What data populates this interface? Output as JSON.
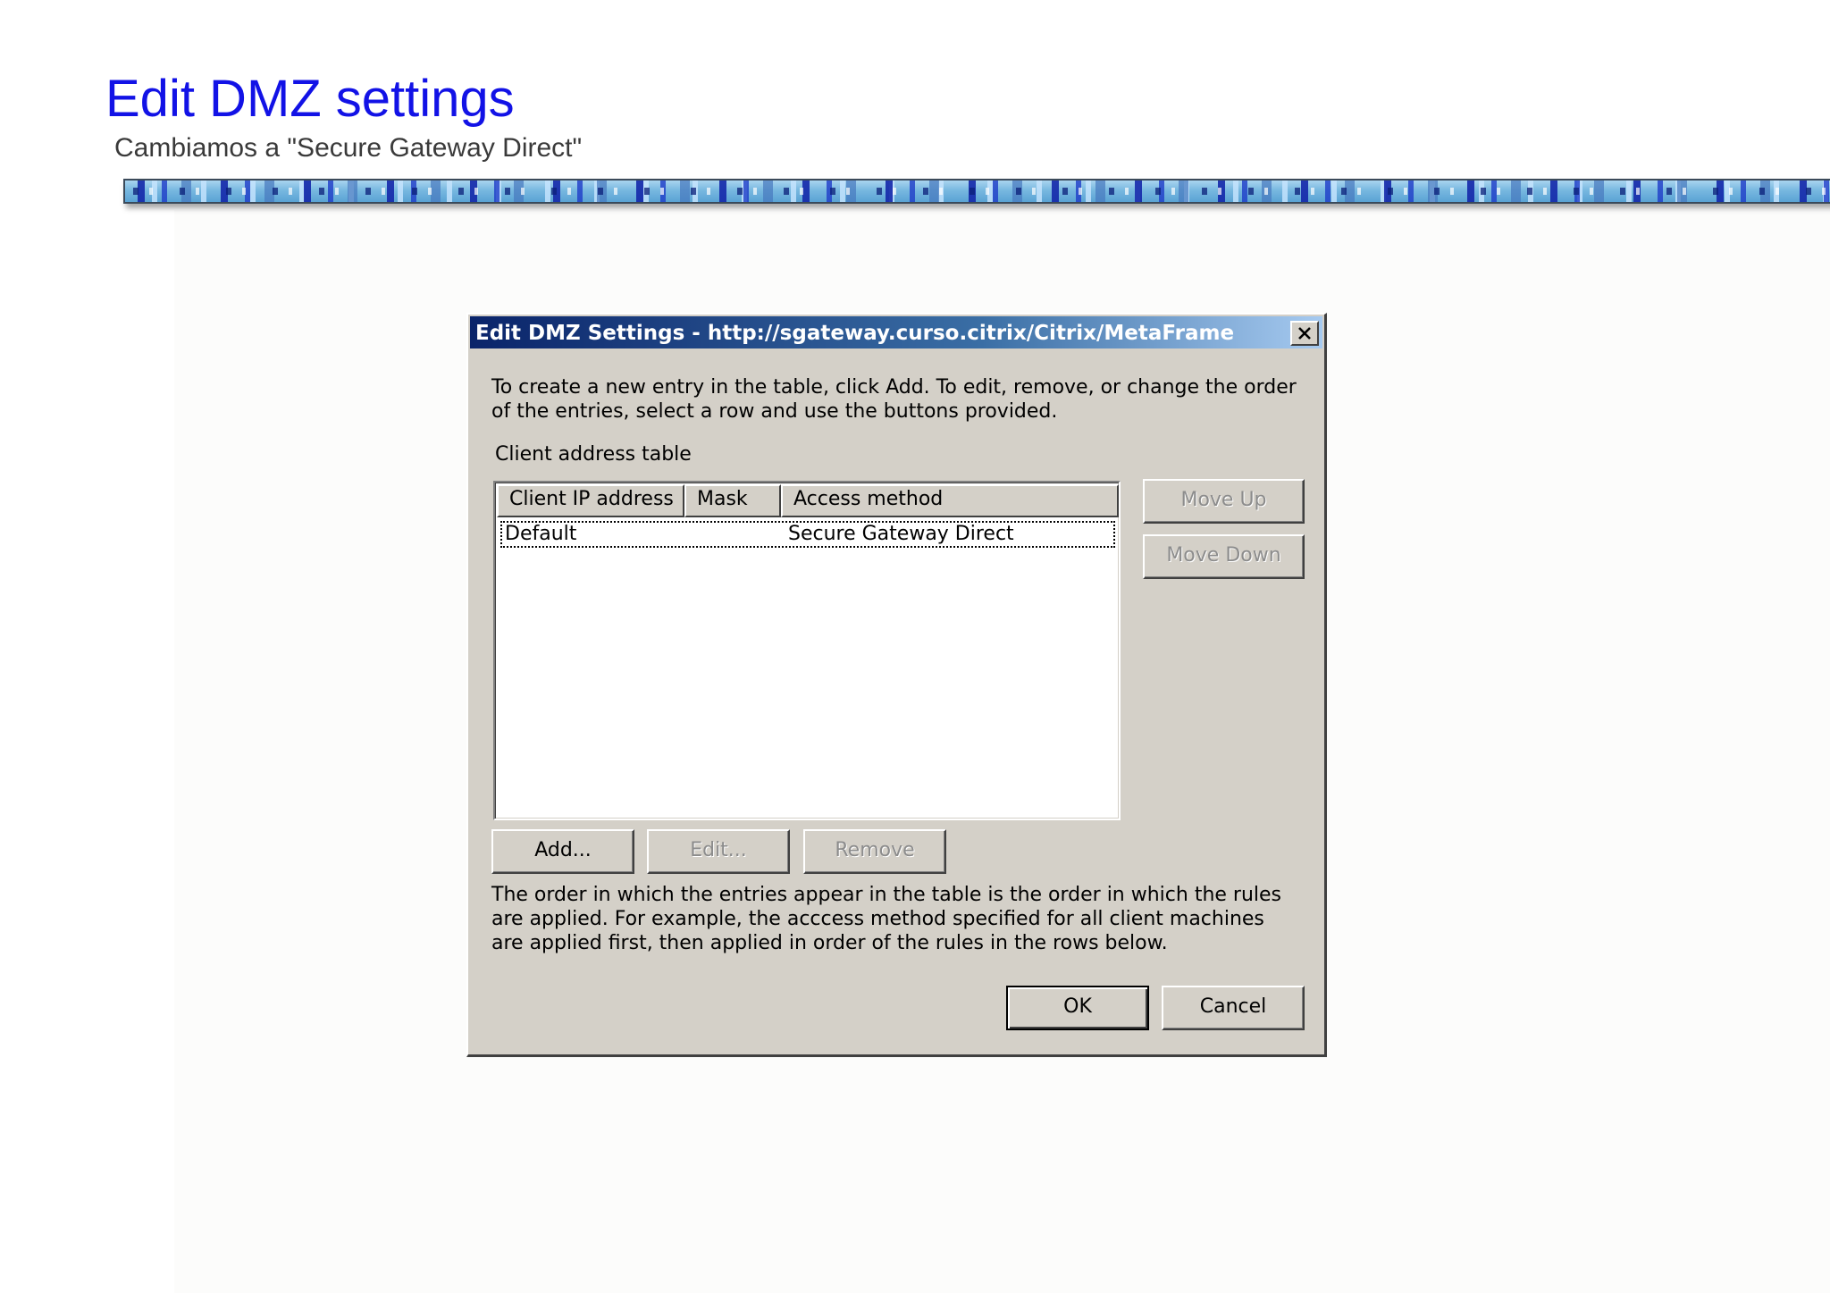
{
  "slide": {
    "title": "Edit DMZ settings",
    "subtitle": "Cambiamos a \"Secure Gateway Direct\"",
    "title_color": "#1212e6"
  },
  "dialog": {
    "title": "Edit DMZ Settings - http://sgateway.curso.citrix/Citrix/MetaFrame",
    "intro": "To create a new entry in the table, click Add. To edit, remove, or change the order of the entries, select a row and use the buttons provided.",
    "table_label": "Client address table",
    "columns": [
      "Client IP address",
      "Mask",
      "Access method"
    ],
    "rows": [
      {
        "client_ip": "Default",
        "mask": "",
        "access_method": "Secure Gateway Direct",
        "selected": true
      }
    ],
    "buttons": {
      "move_up": "Move Up",
      "move_down": "Move Down",
      "add": "Add...",
      "edit": "Edit...",
      "remove": "Remove",
      "ok": "OK",
      "cancel": "Cancel"
    },
    "footer_note": "The order in which the entries appear in the table is the order in which the rules are applied. For example, the acccess method specified for all client machines are applied first, then applied in order of the rules in the rows below.",
    "colors": {
      "titlebar_start": "#0a246a",
      "titlebar_end": "#a6caf0",
      "dialog_face": "#d4d0c8",
      "disabled_text": "#8c8c8c"
    }
  }
}
